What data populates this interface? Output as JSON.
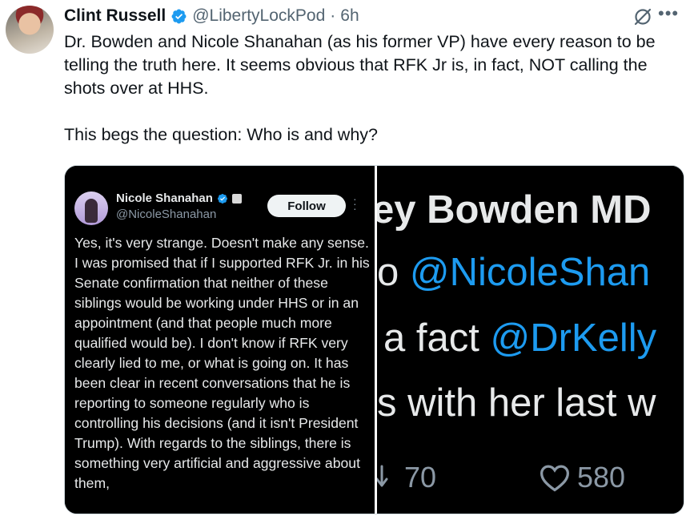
{
  "author": {
    "name": "Clint Russell",
    "handle": "@LibertyLockPod",
    "separator": "·",
    "time": "6h"
  },
  "tweet": {
    "paragraph1": "Dr. Bowden and Nicole Shanahan (as his former VP) have every reason to be telling the truth here. It seems obvious that RFK Jr is, in fact, NOT calling the shots over at HHS.",
    "paragraph2": "This begs the question: Who is and why?"
  },
  "icons": {
    "more": "more-icon",
    "grok": "grok-icon",
    "verified": "verified-badge-icon"
  },
  "colors": {
    "accent": "#1d9bf0",
    "text": "#0f1419",
    "muted": "#536471"
  },
  "media": {
    "left": {
      "name": "Nicole Shanahan",
      "handle": "@NicoleShanahan",
      "follow_label": "Follow",
      "body": "Yes, it's very strange. Doesn't make any sense. I was promised that if I supported RFK Jr. in his Senate confirmation that neither of these siblings would be working under HHS or in an appointment (and that people much more qualified would be). I don't know if RFK very clearly lied to me, or what is going on. It has been clear in recent conversations that he is reporting to someone regularly who is controlling his decisions (and it isn't President Trump). With regards to the siblings, there is something very artificial and aggressive about them,"
    },
    "right": {
      "line1": "ey Bowden MD",
      "line2_prefix": "o ",
      "line2_mention": "@NicoleShan",
      "line3_prefix": "a fact ",
      "line3_mention": "@DrKelly",
      "line4": "s with her last w",
      "retweets": "70",
      "likes": "580"
    }
  }
}
